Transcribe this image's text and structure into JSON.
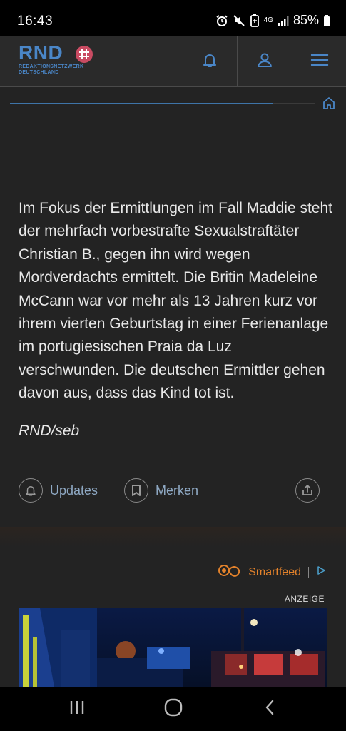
{
  "status_bar": {
    "time": "16:43",
    "network": "4G",
    "battery": "85%"
  },
  "header": {
    "logo_text": "RND",
    "logo_sub_line1": "REDAKTIONSNETZWERK",
    "logo_sub_line2": "DEUTSCHLAND",
    "accent_color": "#4a86c7",
    "badge_color": "#c94b62"
  },
  "reading_progress": 0.86,
  "article": {
    "body": "Im Fokus der Ermittlungen im Fall Maddie steht der mehrfach vorbestrafte Sexualstraftäter Christian B., gegen ihn wird wegen Mordverdachts ermittelt. Die Britin Madeleine McCann war vor mehr als 13 Jahren kurz vor ihrem vierten Geburtstag in einer Ferienanlage im portugiesischen Praia da Luz verschwunden. Die deutschen Ermittler gehen davon aus, dass das Kind tot ist.",
    "byline": "RND/seb"
  },
  "actions": {
    "updates_label": "Updates",
    "merken_label": "Merken"
  },
  "ad": {
    "provider": "Smartfeed",
    "label": "ANZEIGE",
    "provider_color": "#e3822b"
  },
  "icons": {
    "bell": "bell-icon",
    "user": "user-icon",
    "menu": "menu-icon",
    "home": "home-icon",
    "bookmark": "bookmark-icon",
    "share": "share-icon"
  }
}
